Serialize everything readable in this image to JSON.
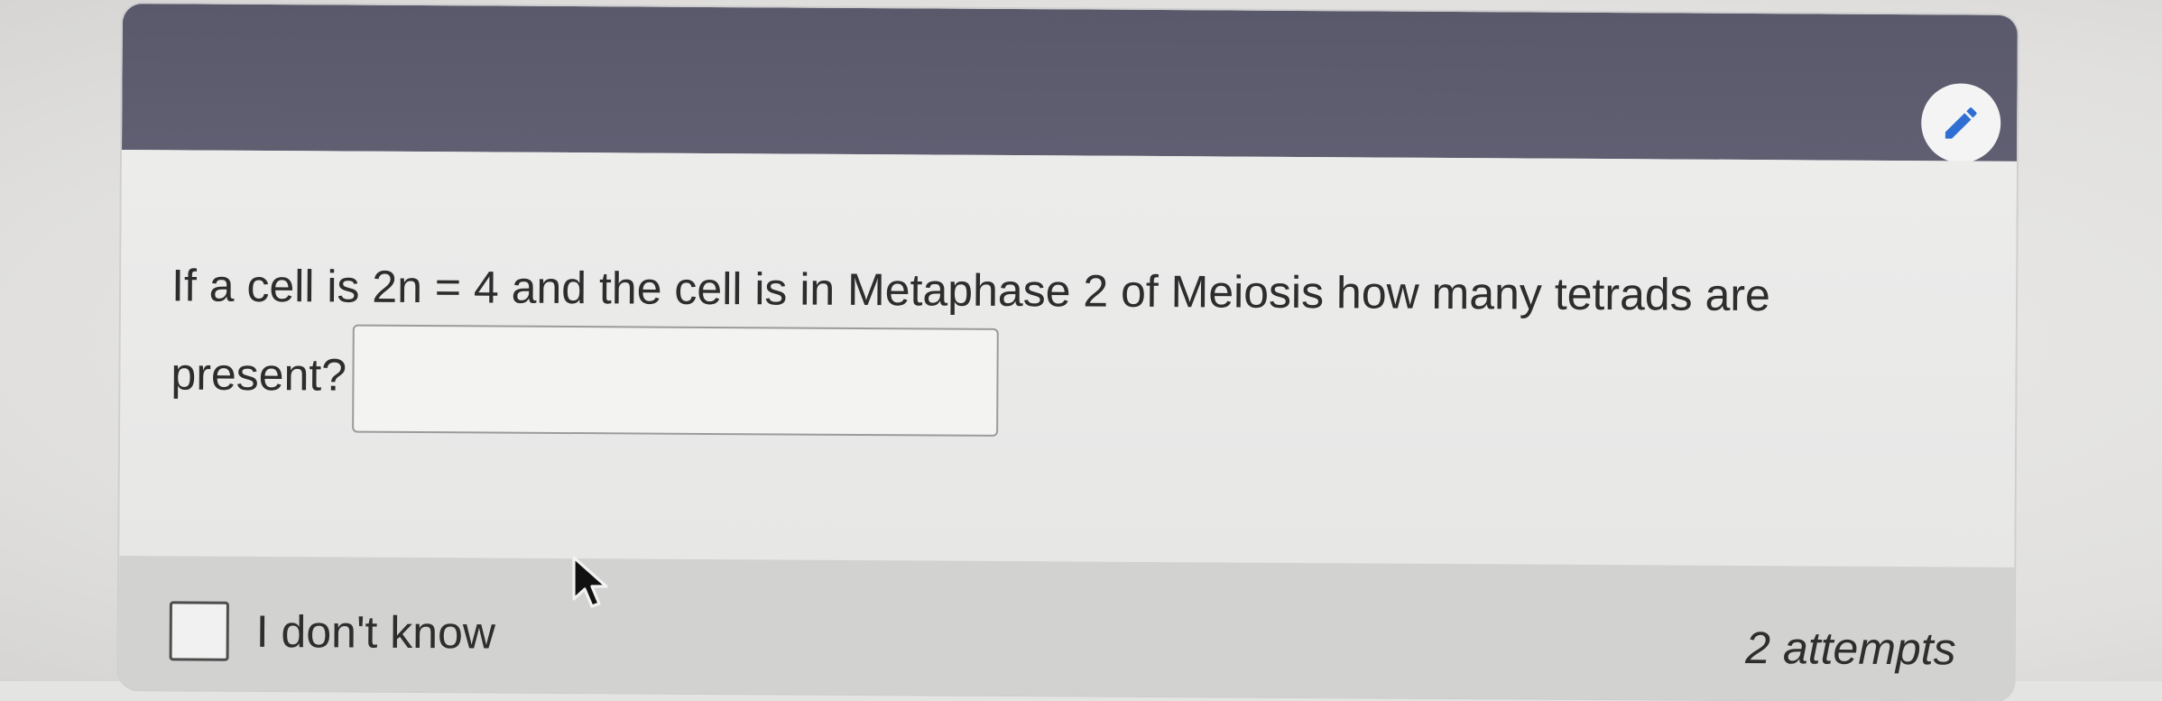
{
  "question": {
    "text_line1": "If a cell is 2n = 4 and the cell is in Metaphase 2 of Meiosis how many tetrads are",
    "text_line2": "present?",
    "answer_value": "",
    "answer_placeholder": ""
  },
  "footer": {
    "dont_know_label": "I don't know",
    "dont_know_checked": false,
    "attempts_label": "2 attempts"
  },
  "icons": {
    "edit": "pencil-icon",
    "cursor": "mouse-pointer-icon"
  },
  "colors": {
    "header": "#5a596b",
    "accent": "#2f6fd3"
  }
}
